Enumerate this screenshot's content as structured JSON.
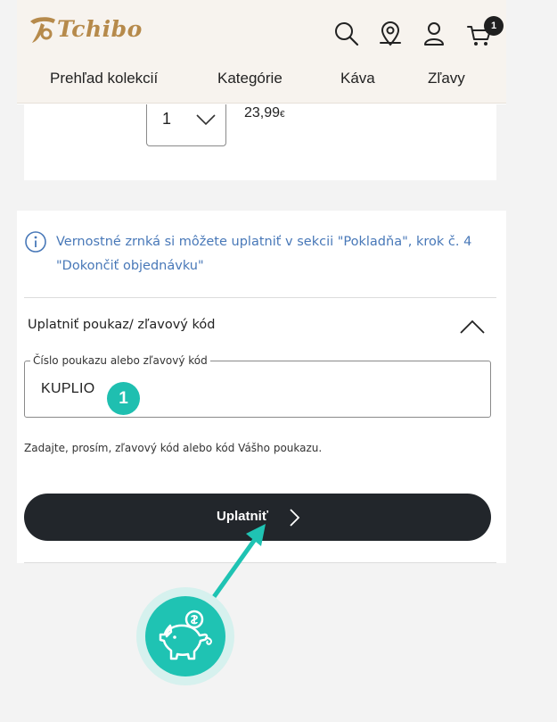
{
  "header": {
    "logo_text": "Tchibo",
    "cart_count": "1",
    "icons": [
      "search-icon",
      "store-locator-icon",
      "account-icon",
      "cart-icon"
    ]
  },
  "nav": {
    "items": [
      "Prehľad kolekcií",
      "Kategórie",
      "Káva",
      "Zľavy"
    ]
  },
  "product": {
    "quantity": "1",
    "price": "23,99",
    "currency": "€"
  },
  "info": {
    "text": "Vernostné zrnká si môžete uplatniť v sekcii \"Pokladňa\", krok č. 4 \"Dokončiť objednávku\""
  },
  "voucher": {
    "title": "Uplatniť poukaz/ zľavový kód",
    "field_label": "Číslo poukazu alebo zľavový kód",
    "field_value": "KUPLIO",
    "hint": "Zadajte, prosím, zľavový kód alebo kód Vášho poukazu.",
    "apply_label": "Uplatniť"
  },
  "annotation": {
    "step_number": "1"
  },
  "colors": {
    "accent": "#1fc3b3",
    "brand_gold": "#b68a4b",
    "info_blue": "#4878b8",
    "button_dark": "#22262b"
  }
}
